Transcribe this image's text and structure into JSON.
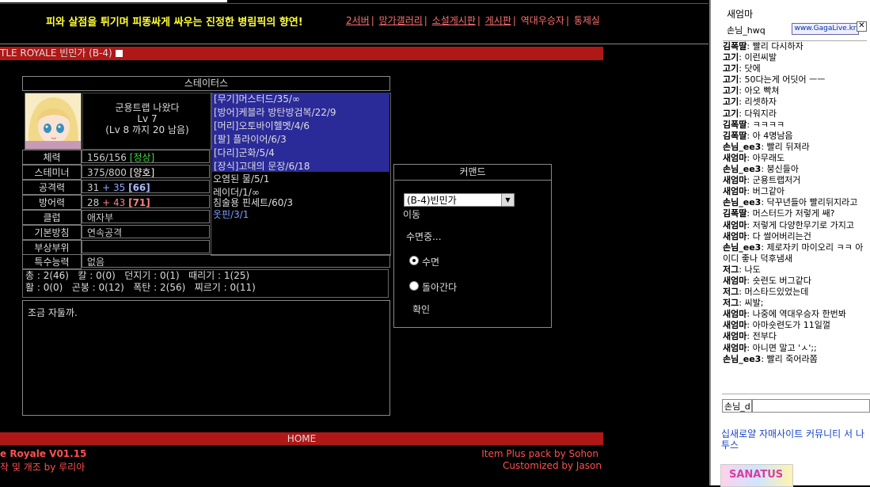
{
  "header": {
    "tagline": "피와 살점을 튀기며 피똥싸게 싸우는 진정한 병림픽의 향연!",
    "links": [
      "2서버",
      "망가갤러리",
      "소설게시판",
      "게시판",
      "역대우승자",
      "통제실"
    ],
    "separator": "|"
  },
  "titlebar": {
    "text": "TLE ROYALE 빈민가 (B-4)"
  },
  "status": {
    "header": "스테이터스",
    "char_name": "군용트랩 나왔다",
    "level": "Lv 7",
    "exp_left": "(Lv 8 까지 20 남음)",
    "rows": [
      {
        "label": "체력",
        "value": "156/156",
        "state": "[정상]"
      },
      {
        "label": "스테미너",
        "value": "375/800",
        "state": "[양호]"
      },
      {
        "label": "공격력",
        "base": "31",
        "bonus": "+ 35",
        "total": "[66]"
      },
      {
        "label": "방어력",
        "base": "28",
        "bonus": "+ 43",
        "total": "[71]"
      },
      {
        "label": "클럽",
        "value": "애자부"
      },
      {
        "label": "기본방침",
        "value": "연속공격"
      },
      {
        "label": "부상부위",
        "value": ""
      }
    ],
    "ability_label": "특수능력",
    "ability_value": "없음",
    "equipment": [
      "[무기]머스터드/35/∞",
      "[방어]케블라 방탄방검복/22/9",
      "[머리]오토바이헬멧/4/6",
      "[팔]  플라이어/6/3",
      "[다리]군화/5/4",
      "[장식]고대의 문장/6/18"
    ],
    "inventory": [
      "오염된 물/5/1",
      "레이더/1/∞",
      "침술용 핀세트/60/3",
      "옷핀/3/1"
    ],
    "skills_line1": "총 : 2(46)   칼 : 0(0)   던지기 : 0(1)   때리기 : 1(25)",
    "skills_line2": "활 : 0(0)   곤봉 : 0(12)   폭탄 : 2(56)   찌르기 : 0(11)",
    "message": "조금 자둘까."
  },
  "command": {
    "header": "커맨드",
    "location_select": "(B-4)빈민가",
    "move_label": "이동",
    "status_text": "수면중...",
    "options": [
      {
        "label": "수면",
        "selected": true
      },
      {
        "label": "돌아간다",
        "selected": false
      }
    ],
    "confirm": "확인"
  },
  "footer": {
    "home": "HOME",
    "version": "e Royale V01.15",
    "modded_by": "작 및 개조 by 루리아",
    "item_plus": "Item Plus pack by Sohon",
    "customized": "Customized by Jason"
  },
  "sidebar": {
    "user1": "새엄마",
    "user2": "손님_hwq",
    "badge": "www.GagaLive.kr",
    "close": "✕",
    "chat": [
      {
        "name": "김폭딸",
        "msg": "빨리 다시하자"
      },
      {
        "name": "고기",
        "msg": "이런씨발"
      },
      {
        "name": "고기",
        "msg": "닷에"
      },
      {
        "name": "고기",
        "msg": "50다는게 어딧어 ㅡㅡ"
      },
      {
        "name": "고기",
        "msg": "아오 빡쳐"
      },
      {
        "name": "고기",
        "msg": "리셋하자"
      },
      {
        "name": "고기",
        "msg": "다워지라"
      },
      {
        "name": "김폭딸",
        "msg": "ㅋㅋㅋㅋ"
      },
      {
        "name": "김폭딸",
        "msg": "아 4명남음"
      },
      {
        "name": "손님_ee3",
        "msg": "빨리 뒤져라"
      },
      {
        "name": "새엄마",
        "msg": "아무래도"
      },
      {
        "name": "손님_ee3",
        "msg": "붕신들아"
      },
      {
        "name": "새엄마",
        "msg": "군용트랩저거"
      },
      {
        "name": "새엄마",
        "msg": "버그같아"
      },
      {
        "name": "손님_ee3",
        "msg": "닥꾸년들아 빨리뒤지라고"
      },
      {
        "name": "김폭딸",
        "msg": "머스터드가 저렇게 쌔?"
      },
      {
        "name": "새엄마",
        "msg": "저렇게 다양한무기로 가지고"
      },
      {
        "name": "새엄마",
        "msg": "다 썰어버리는건"
      },
      {
        "name": "손님_ee3",
        "msg": "제로자키 마이오리 ㅋㅋ 아이디 좋나 덕후냄새"
      },
      {
        "name": "저그",
        "msg": "나도"
      },
      {
        "name": "새엄마",
        "msg": "숏련도 버그같다"
      },
      {
        "name": "저그",
        "msg": "머스타드있었는데"
      },
      {
        "name": "저그",
        "msg": "씨발;"
      },
      {
        "name": "새엄마",
        "msg": "나중에 역대우승자 한번봐"
      },
      {
        "name": "새엄마",
        "msg": "아마숏련도가 11일껄"
      },
      {
        "name": "새엄마",
        "msg": "전부다"
      },
      {
        "name": "새엄마",
        "msg": "아니면 말고 'ㅅ';;"
      },
      {
        "name": "손님_ee3",
        "msg": "빨리 죽어라쫌"
      }
    ],
    "chat_name": "손님_d",
    "chat_placeholder": "",
    "link_text": "십새로얄 자매사이트 커뮤니티 서 나투스",
    "logo": "SANATUS"
  },
  "colors": {
    "red_bar": "#b01818",
    "equip_bg": "#2a2a99",
    "tagline": "#ffff33",
    "nav_link": "#ff7070"
  }
}
